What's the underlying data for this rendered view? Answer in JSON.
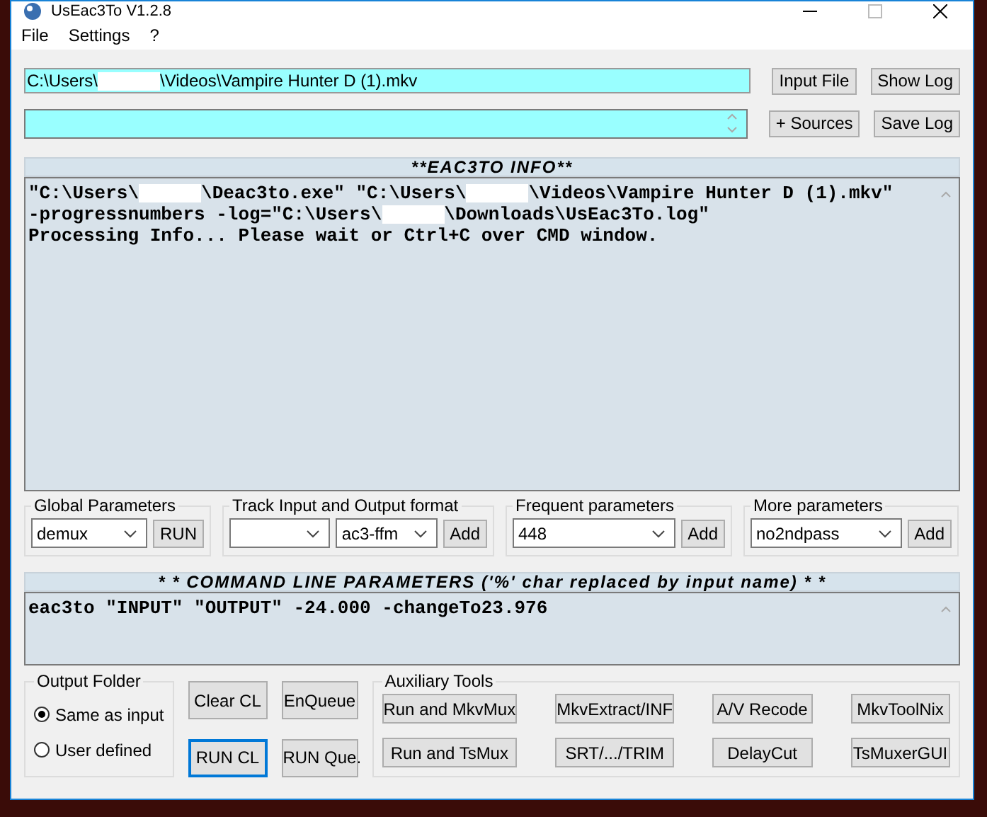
{
  "window": {
    "title": "UsEac3To V1.2.8"
  },
  "menu": [
    {
      "label": "File"
    },
    {
      "label": "Settings"
    },
    {
      "label": "?"
    }
  ],
  "input_file": {
    "value_parts": [
      "C:\\Users\\",
      "\\Videos\\Vampire Hunter D (1).mkv"
    ]
  },
  "side_buttons": [
    {
      "label": "Input File"
    },
    {
      "label": "Show Log"
    },
    {
      "label": "+ Sources"
    },
    {
      "label": "Save Log"
    }
  ],
  "info": {
    "title": "**EAC3TO INFO**",
    "lines": [
      {
        "parts": [
          "\"C:\\Users\\",
          "\\Deac3to.exe\" \"C:\\Users\\",
          "\\Videos\\Vampire Hunter D (1).mkv\""
        ]
      },
      {
        "parts": [
          "-progressnumbers -log=\"C:\\Users\\",
          "\\Downloads\\UsEac3To.log\""
        ]
      },
      {
        "parts": [
          "Processing Info... Please wait or Ctrl+C over CMD window."
        ]
      }
    ]
  },
  "parameter_groups": [
    {
      "title": "Global Parameters",
      "controls": [
        {
          "kind": "dropdown",
          "value": "demux"
        },
        {
          "kind": "button",
          "label": "RUN"
        }
      ]
    },
    {
      "title": "Track Input and Output format",
      "controls": [
        {
          "kind": "dropdown"
        },
        {
          "kind": "dropdown",
          "value": "ac3-ffm"
        },
        {
          "kind": "button",
          "label": "Add"
        }
      ]
    },
    {
      "title": "Frequent parameters",
      "controls": [
        {
          "kind": "dropdown",
          "value": "448"
        },
        {
          "kind": "button",
          "label": "Add"
        }
      ]
    },
    {
      "title": "More parameters",
      "controls": [
        {
          "kind": "dropdown",
          "value": "no2ndpass"
        },
        {
          "kind": "button",
          "label": "Add"
        }
      ]
    }
  ],
  "command_line": {
    "title": "* * COMMAND LINE PARAMETERS ('%' char replaced by input name) * *",
    "text": "eac3to \"INPUT\" \"OUTPUT\" -24.000 -changeTo23.976"
  },
  "output_folder": {
    "title": "Output Folder",
    "options": [
      {
        "label": "Same as input",
        "selected": true
      },
      {
        "label": "User defined",
        "selected": false
      }
    ]
  },
  "queue_buttons": [
    {
      "label": "Clear CL",
      "focused": false
    },
    {
      "label": "EnQueue",
      "focused": false
    },
    {
      "label": "RUN CL",
      "focused": true
    },
    {
      "label": "RUN Que.",
      "focused": false
    }
  ],
  "auxiliary_tools": {
    "title": "Auxiliary Tools",
    "buttons": [
      "Run and MkvMux",
      "MkvExtract/INF",
      "A/V Recode",
      "MkvToolNix",
      "Run and TsMux",
      "SRT/.../TRIM",
      "DelayCut",
      "TsMuxerGUI"
    ]
  }
}
